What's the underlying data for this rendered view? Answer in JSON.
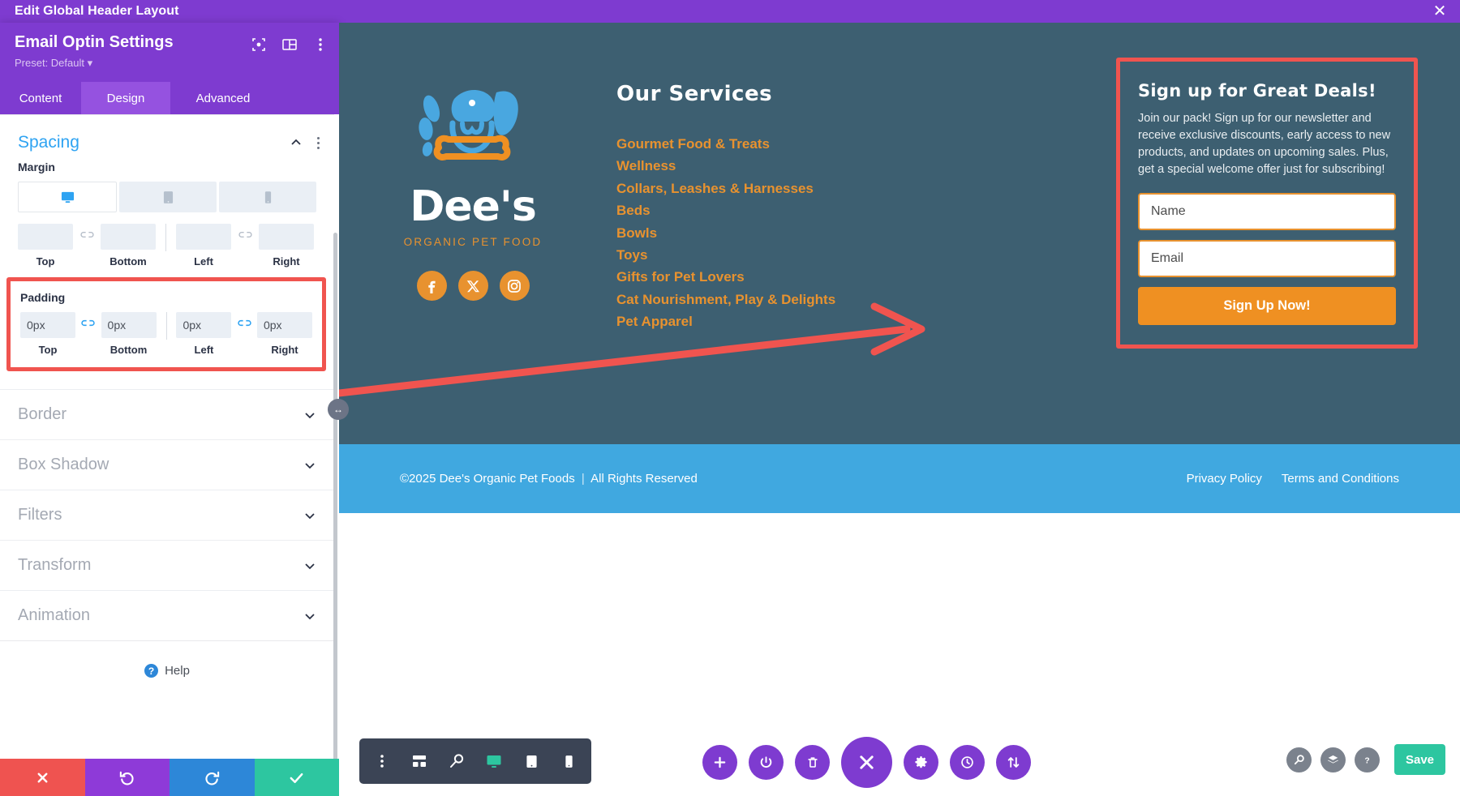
{
  "titlebar": {
    "title": "Edit Global Header Layout",
    "close_icon": "close-icon"
  },
  "settings_panel": {
    "module_title": "Email Optin Settings",
    "preset": "Preset: Default",
    "head_icons": [
      "target-icon",
      "layout-columns-icon",
      "kebab-menu-icon"
    ],
    "tabs": [
      {
        "label": "Content",
        "active": false
      },
      {
        "label": "Design",
        "active": true
      },
      {
        "label": "Advanced",
        "active": false
      }
    ],
    "spacing": {
      "title": "Spacing",
      "margin": {
        "label": "Margin",
        "devices": [
          "desktop-icon",
          "tablet-icon",
          "phone-icon"
        ],
        "active_device": 0,
        "fields": [
          {
            "caption": "Top",
            "value": ""
          },
          {
            "caption": "Bottom",
            "value": ""
          },
          {
            "caption": "Left",
            "value": ""
          },
          {
            "caption": "Right",
            "value": ""
          }
        ]
      },
      "padding": {
        "label": "Padding",
        "fields": [
          {
            "caption": "Top",
            "value": "0px"
          },
          {
            "caption": "Bottom",
            "value": "0px"
          },
          {
            "caption": "Left",
            "value": "0px"
          },
          {
            "caption": "Right",
            "value": "0px"
          }
        ]
      }
    },
    "accordions": [
      {
        "label": "Border"
      },
      {
        "label": "Box Shadow"
      },
      {
        "label": "Filters"
      },
      {
        "label": "Transform"
      },
      {
        "label": "Animation"
      }
    ],
    "help": {
      "label": "Help",
      "badge": "?"
    },
    "footer_buttons": [
      {
        "name": "discard",
        "icon": "x-icon"
      },
      {
        "name": "undo",
        "icon": "undo-icon"
      },
      {
        "name": "redo",
        "icon": "redo-icon"
      },
      {
        "name": "apply",
        "icon": "check-icon"
      }
    ]
  },
  "site": {
    "logo": {
      "wordmark": "Dee's",
      "tagline": "ORGANIC PET FOOD"
    },
    "socials": [
      {
        "name": "facebook-icon"
      },
      {
        "name": "x-twitter-icon"
      },
      {
        "name": "instagram-icon"
      }
    ],
    "services": {
      "title": "Our Services",
      "items": [
        "Gourmet Food & Treats",
        "Wellness",
        "Collars, Leashes & Harnesses",
        "Beds",
        "Bowls",
        "Toys",
        "Gifts for Pet Lovers",
        "Cat Nourishment, Play & Delights",
        "Pet Apparel"
      ]
    },
    "optin": {
      "title": "Sign up for Great Deals!",
      "description": "Join our pack! Sign up for our newsletter and receive exclusive discounts, early access to new products, and updates on upcoming sales. Plus, get a special welcome offer just for subscribing!",
      "name_placeholder": "Name",
      "name_value": "",
      "email_placeholder": "Email",
      "email_value": "",
      "submit_label": "Sign Up Now!"
    },
    "footer": {
      "copyright_left": "©2025 Dee's Organic Pet Foods",
      "copyright_sep": "|",
      "copyright_right": "All Rights Reserved",
      "links": [
        "Privacy Policy",
        "Terms and Conditions"
      ]
    }
  },
  "builder_toolbar": {
    "left_tools": [
      {
        "name": "kebab-menu-icon"
      },
      {
        "name": "wireframe-icon"
      },
      {
        "name": "zoom-out-icon"
      },
      {
        "name": "desktop-view-icon",
        "active": true
      },
      {
        "name": "tablet-view-icon"
      },
      {
        "name": "phone-view-icon"
      }
    ],
    "round_tools": [
      {
        "name": "add-icon"
      },
      {
        "name": "power-icon"
      },
      {
        "name": "trash-icon"
      },
      {
        "name": "close-builder-icon",
        "big": true
      },
      {
        "name": "settings-gear-icon"
      },
      {
        "name": "history-clock-icon"
      },
      {
        "name": "sort-updown-icon"
      }
    ],
    "corner_tools": [
      {
        "name": "search-icon"
      },
      {
        "name": "layers-icon"
      },
      {
        "name": "help-icon"
      }
    ],
    "save_label": "Save"
  },
  "colors": {
    "purple": "#7e3bd0",
    "accent_blue": "#2ea3f2",
    "highlight_red": "#f0544f",
    "site_dark": "#3d5f71",
    "site_orange": "#e8922f",
    "footer_blue": "#40a8e0",
    "save_green": "#2dc6a0"
  }
}
